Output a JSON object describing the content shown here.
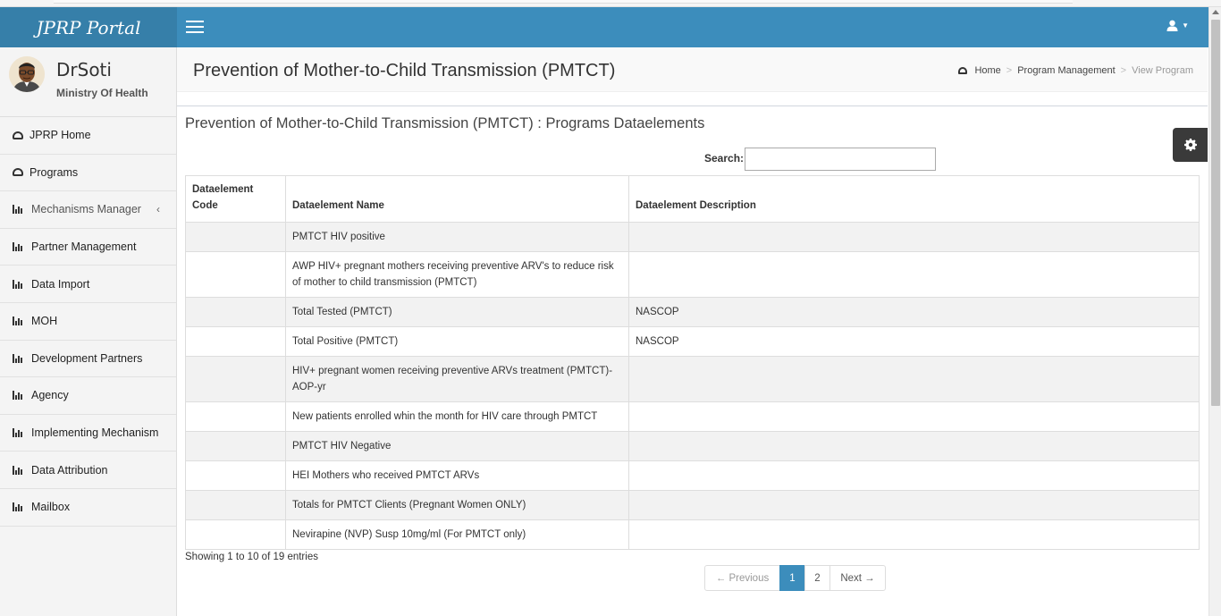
{
  "header": {
    "brand": "JPRP Portal",
    "user_icon": "user-icon"
  },
  "sidebar": {
    "user_name": "DrSoti",
    "user_org": "Ministry Of Health",
    "items": [
      {
        "label": "JPRP Home",
        "icon": "dashboard-icon"
      },
      {
        "label": "Programs",
        "icon": "dashboard-icon"
      },
      {
        "label": "Mechanisms Manager",
        "icon": "bar-chart-icon"
      },
      {
        "label": "Partner Management",
        "icon": "bar-chart-icon"
      },
      {
        "label": "Data Import",
        "icon": "bar-chart-icon"
      },
      {
        "label": "MOH",
        "icon": "bar-chart-icon"
      },
      {
        "label": "Development Partners",
        "icon": "bar-chart-icon"
      },
      {
        "label": "Agency",
        "icon": "bar-chart-icon"
      },
      {
        "label": "Implementing Mechanism",
        "icon": "bar-chart-icon"
      },
      {
        "label": "Data Attribution",
        "icon": "bar-chart-icon"
      },
      {
        "label": "Mailbox",
        "icon": "bar-chart-icon"
      }
    ]
  },
  "content": {
    "page_title": "Prevention of Mother-to-Child Transmission (PMTCT)",
    "breadcrumb": {
      "home": "Home",
      "section": "Program Management",
      "current": "View Program"
    },
    "section_title": "Prevention of Mother-to-Child Transmission (PMTCT) : Programs Dataelements",
    "search_label": "Search:",
    "search_value": ""
  },
  "table": {
    "columns": [
      "Dataelement Code",
      "Dataelement Name",
      "Dataelement Description"
    ],
    "rows": [
      {
        "code": "",
        "name": "PMTCT HIV positive",
        "description": ""
      },
      {
        "code": "",
        "name": "AWP HIV+ pregnant mothers receiving preventive ARV's to reduce risk of mother to child transmission (PMTCT)",
        "description": ""
      },
      {
        "code": "",
        "name": "Total Tested (PMTCT)",
        "description": "NASCOP"
      },
      {
        "code": "",
        "name": "Total Positive (PMTCT)",
        "description": "NASCOP"
      },
      {
        "code": "",
        "name": "HIV+ pregnant women receiving preventive ARVs treatment (PMTCT)-AOP-yr",
        "description": ""
      },
      {
        "code": "",
        "name": "New patients enrolled whin the month for HIV care through PMTCT",
        "description": ""
      },
      {
        "code": "",
        "name": "PMTCT HIV Negative",
        "description": ""
      },
      {
        "code": "",
        "name": "HEI Mothers who received PMTCT ARVs",
        "description": ""
      },
      {
        "code": "",
        "name": "Totals for PMTCT Clients (Pregnant Women ONLY)",
        "description": ""
      },
      {
        "code": "",
        "name": "Nevirapine (NVP) Susp 10mg/ml (For PMTCT only)",
        "description": ""
      }
    ]
  },
  "footer": {
    "info": "Showing 1 to 10 of 19 entries",
    "pagination": {
      "previous": "← Previous",
      "pages": [
        "1",
        "2"
      ],
      "next": "Next →"
    }
  },
  "colors": {
    "primary": "#3c8dbc",
    "logo_bg": "#367fa9"
  }
}
